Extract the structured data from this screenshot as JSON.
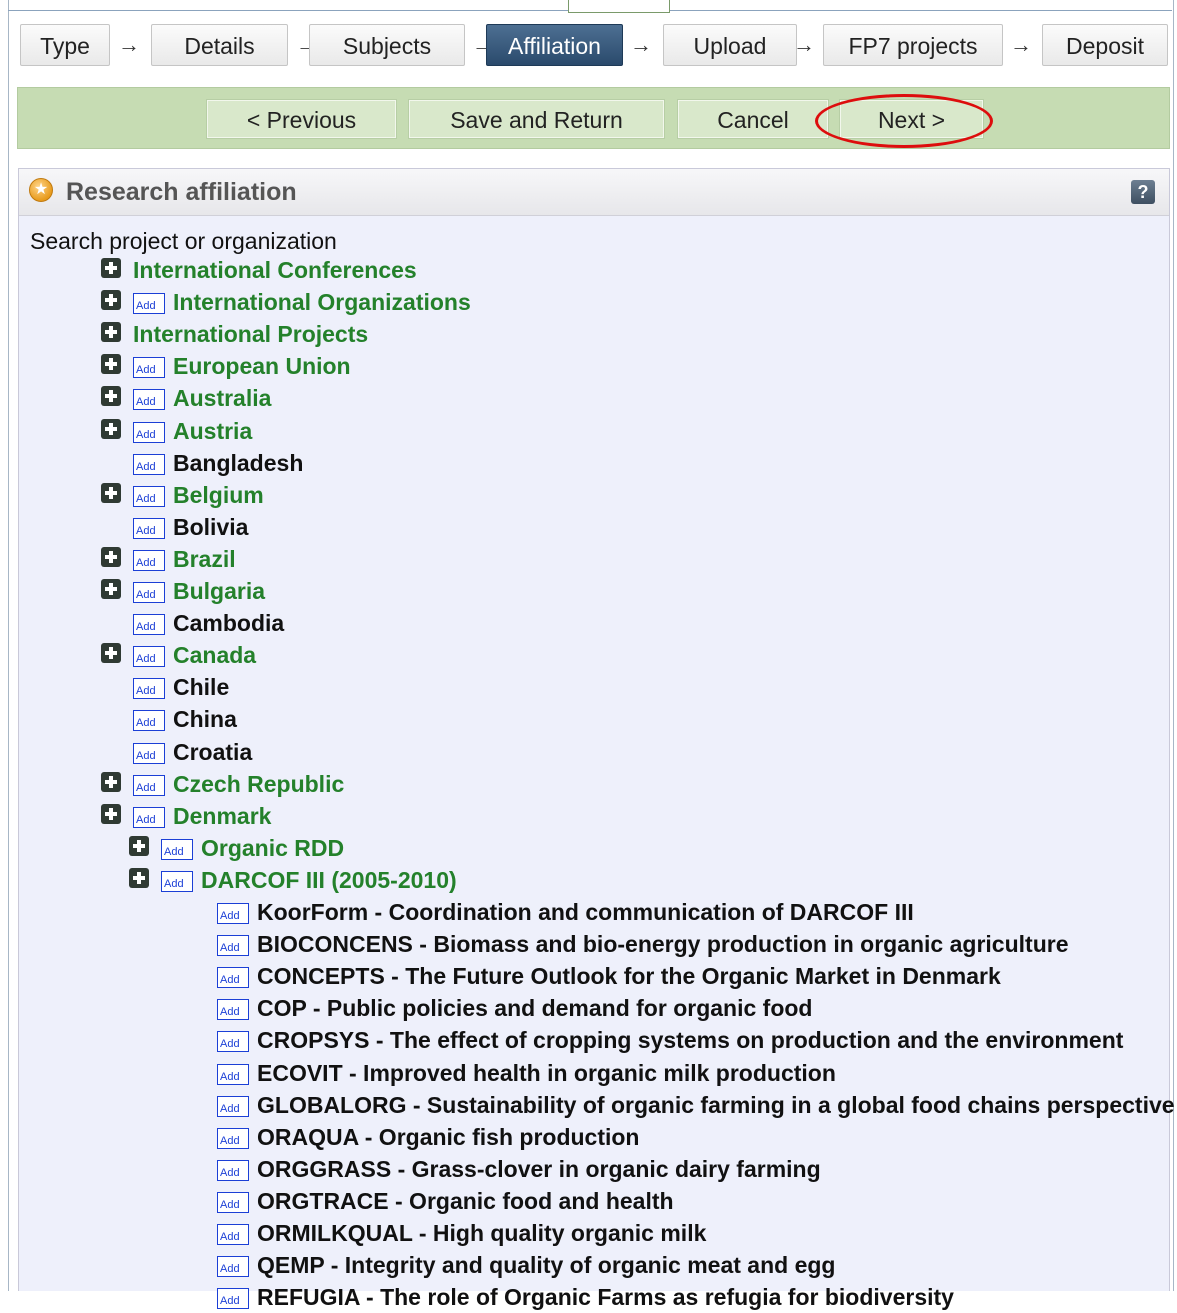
{
  "steps": [
    "Type",
    "Details",
    "Subjects",
    "Affiliation",
    "Upload",
    "FP7 projects",
    "Deposit"
  ],
  "step_arrow": "→",
  "active_step": "Affiliation",
  "actions": {
    "previous": "< Previous",
    "save_return": "Save and Return",
    "cancel": "Cancel",
    "next": "Next >"
  },
  "panel": {
    "title": "Research affiliation",
    "help": "?",
    "search_label": "Search project or organization",
    "add_badge": "Add"
  },
  "tree": [
    {
      "label": "International Conferences",
      "expand": true,
      "add": false,
      "link": true,
      "level": 0
    },
    {
      "label": "International Organizations",
      "expand": true,
      "add": true,
      "link": true,
      "level": 0
    },
    {
      "label": "International Projects",
      "expand": true,
      "add": false,
      "link": true,
      "level": 0
    },
    {
      "label": "European Union",
      "expand": true,
      "add": true,
      "link": true,
      "level": 0
    },
    {
      "label": "Australia",
      "expand": true,
      "add": true,
      "link": true,
      "level": 0
    },
    {
      "label": "Austria",
      "expand": true,
      "add": true,
      "link": true,
      "level": 0
    },
    {
      "label": "Bangladesh",
      "expand": false,
      "add": true,
      "link": false,
      "level": 0
    },
    {
      "label": "Belgium",
      "expand": true,
      "add": true,
      "link": true,
      "level": 0
    },
    {
      "label": "Bolivia",
      "expand": false,
      "add": true,
      "link": false,
      "level": 0
    },
    {
      "label": "Brazil",
      "expand": true,
      "add": true,
      "link": true,
      "level": 0
    },
    {
      "label": "Bulgaria",
      "expand": true,
      "add": true,
      "link": true,
      "level": 0
    },
    {
      "label": "Cambodia",
      "expand": false,
      "add": true,
      "link": false,
      "level": 0
    },
    {
      "label": "Canada",
      "expand": true,
      "add": true,
      "link": true,
      "level": 0
    },
    {
      "label": "Chile",
      "expand": false,
      "add": true,
      "link": false,
      "level": 0
    },
    {
      "label": "China",
      "expand": false,
      "add": true,
      "link": false,
      "level": 0
    },
    {
      "label": "Croatia",
      "expand": false,
      "add": true,
      "link": false,
      "level": 0
    },
    {
      "label": "Czech Republic",
      "expand": true,
      "add": true,
      "link": true,
      "level": 0
    },
    {
      "label": "Denmark",
      "expand": true,
      "add": true,
      "link": true,
      "level": 0
    },
    {
      "label": "Organic RDD",
      "expand": true,
      "add": true,
      "link": true,
      "level": 1
    },
    {
      "label": "DARCOF III (2005-2010)",
      "expand": true,
      "add": true,
      "link": true,
      "level": 1
    },
    {
      "label": "KoorForm - Coordination and communication of DARCOF III",
      "expand": false,
      "add": true,
      "link": false,
      "level": 2
    },
    {
      "label": "BIOCONCENS - Biomass and bio-energy production in organic agriculture",
      "expand": false,
      "add": true,
      "link": false,
      "level": 2
    },
    {
      "label": "CONCEPTS - The Future Outlook for the Organic Market in Denmark",
      "expand": false,
      "add": true,
      "link": false,
      "level": 2
    },
    {
      "label": "COP - Public policies and demand for organic food",
      "expand": false,
      "add": true,
      "link": false,
      "level": 2
    },
    {
      "label": "CROPSYS - The effect of cropping systems on production and the environment",
      "expand": false,
      "add": true,
      "link": false,
      "level": 2
    },
    {
      "label": "ECOVIT - Improved health in organic milk production",
      "expand": false,
      "add": true,
      "link": false,
      "level": 2
    },
    {
      "label": "GLOBALORG - Sustainability of organic farming in a global food chains perspective",
      "expand": false,
      "add": true,
      "link": false,
      "level": 2
    },
    {
      "label": "ORAQUA - Organic fish production",
      "expand": false,
      "add": true,
      "link": false,
      "level": 2
    },
    {
      "label": "ORGGRASS - Grass-clover in organic dairy farming",
      "expand": false,
      "add": true,
      "link": false,
      "level": 2
    },
    {
      "label": "ORGTRACE - Organic food and health",
      "expand": false,
      "add": true,
      "link": false,
      "level": 2
    },
    {
      "label": "ORMILKQUAL - High quality organic milk",
      "expand": false,
      "add": true,
      "link": false,
      "level": 2
    },
    {
      "label": "QEMP - Integrity and quality of organic meat and egg",
      "expand": false,
      "add": true,
      "link": false,
      "level": 2
    },
    {
      "label": "REFUGIA - The role of Organic Farms as refugia for biodiversity",
      "expand": false,
      "add": true,
      "link": false,
      "level": 2
    }
  ]
}
